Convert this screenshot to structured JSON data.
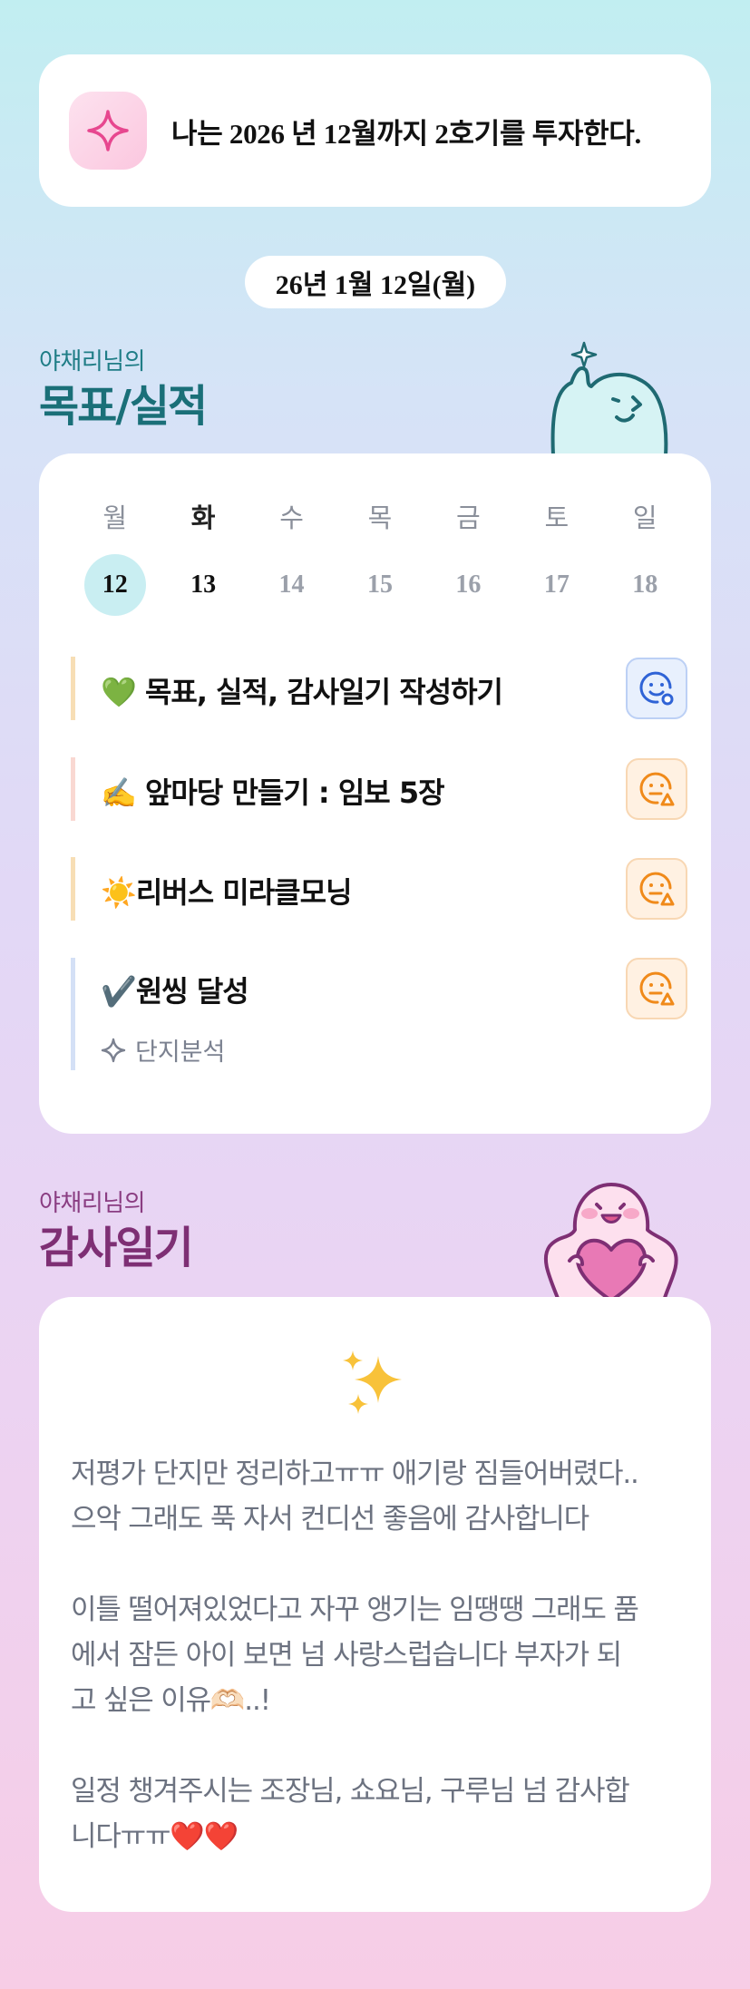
{
  "goal": {
    "icon": "sparkle-icon",
    "text": "나는 2026 년 12월까지 2호기를 투자한다."
  },
  "date": "26년 1월 12일(월)",
  "goals_section": {
    "subtitle": "야채리님의",
    "title": "목표/실적"
  },
  "calendar": {
    "weekdays": [
      "월",
      "화",
      "수",
      "목",
      "금",
      "토",
      "일"
    ],
    "days": [
      "12",
      "13",
      "14",
      "15",
      "16",
      "17",
      "18"
    ],
    "selected_index": 0
  },
  "tasks": [
    {
      "label": "💚 목표, 실적, 감사일기 작성하기",
      "status": "completed",
      "bar_color": "#f7deb5",
      "button_color": "#2f63d6"
    },
    {
      "label": "✍️ 앞마당 만들기 : 임보 5장",
      "status": "pending",
      "bar_color": "#f9d8d2",
      "button_color": "#f08a1a"
    },
    {
      "label": "☀️리버스 미라클모닝",
      "status": "pending",
      "bar_color": "#f7deb5",
      "button_color": "#f08a1a"
    },
    {
      "label": "✔️원씽 달성",
      "status": "pending",
      "bar_color": "#d4e0f6",
      "button_color": "#f08a1a",
      "sub": "단지분석"
    }
  ],
  "gratitude_section": {
    "subtitle": "야채리님의",
    "title": "감사일기"
  },
  "diary": {
    "lines": [
      "저평가 단지만 정리하고ㅠㅠ 애기랑 짐들어버렸다..",
      "으악 그래도 푹 자서 컨디선 좋음에 감사합니다",
      "",
      "이틀 떨어져있었다고 자꾸 앵기는 임땡땡 그래도 품",
      "에서 잠든 아이 보면 넘 사랑스럽습니다 부자가 되",
      "고 싶은 이유🫶🏻..!",
      "",
      "일정 챙겨주시는 조장님, 쇼요님, 구루님 넘 감사합",
      "니다ㅠㅠ❤️❤️"
    ]
  }
}
